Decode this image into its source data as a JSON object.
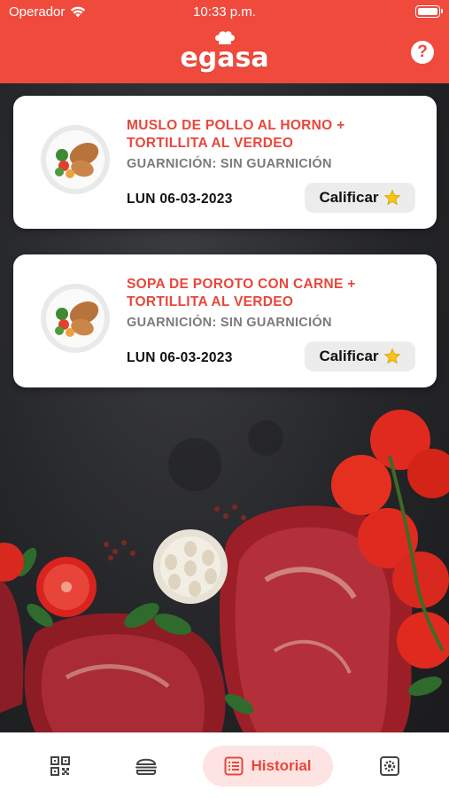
{
  "status_bar": {
    "carrier": "Operador",
    "time": "10:33 p.m."
  },
  "header": {
    "logo_text": "egasa",
    "help_label": "?"
  },
  "orders": [
    {
      "title": "MUSLO DE POLLO AL HORNO + TORTILLITA AL VERDEO",
      "garnish": "GUARNICIÓN: SIN GUARNICIÓN",
      "date": "LUN 06-03-2023",
      "rate_label": "Calificar"
    },
    {
      "title": "SOPA DE POROTO CON CARNE + TORTILLITA AL VERDEO",
      "garnish": "GUARNICIÓN: SIN GUARNICIÓN",
      "date": "LUN 06-03-2023",
      "rate_label": "Calificar"
    }
  ],
  "tab_bar": {
    "items": [
      {
        "icon": "qr-code-icon",
        "label": ""
      },
      {
        "icon": "burger-icon",
        "label": ""
      },
      {
        "icon": "list-icon",
        "label": "Historial",
        "active": true
      },
      {
        "icon": "settings-icon",
        "label": ""
      }
    ]
  },
  "colors": {
    "brand": "#ef4a3c",
    "active_tab_bg": "#fde3e1",
    "star": "#f5c518"
  }
}
